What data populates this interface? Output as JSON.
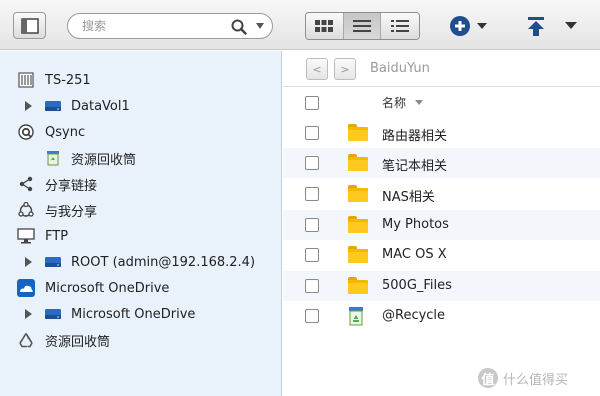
{
  "toolbar": {
    "search": {
      "placeholder": "搜索"
    },
    "view_modes": [
      "thumbnail-view",
      "list-view",
      "detail-view"
    ],
    "active_view": "list-view"
  },
  "sidebar": {
    "items": [
      {
        "label": "TS-251",
        "icon": "nas-icon",
        "indent": 0,
        "expandable": false
      },
      {
        "label": "DataVol1",
        "icon": "drive-icon",
        "indent": 1,
        "expandable": true
      },
      {
        "label": "Qsync",
        "icon": "qsync-icon",
        "indent": 0,
        "expandable": false
      },
      {
        "label": "资源回收筒",
        "icon": "recycle-bin-icon",
        "indent": 2,
        "expandable": false
      },
      {
        "label": "分享链接",
        "icon": "share-link-icon",
        "indent": 0,
        "expandable": false
      },
      {
        "label": "与我分享",
        "icon": "shared-with-me-icon",
        "indent": 0,
        "expandable": false
      },
      {
        "label": "FTP",
        "icon": "ftp-monitor-icon",
        "indent": 0,
        "expandable": false
      },
      {
        "label": "ROOT (admin@192.168.2.4)",
        "icon": "drive-icon",
        "indent": 1,
        "expandable": true
      },
      {
        "label": "Microsoft OneDrive",
        "icon": "onedrive-icon",
        "indent": 0,
        "expandable": false
      },
      {
        "label": "Microsoft OneDrive",
        "icon": "drive-icon",
        "indent": 1,
        "expandable": true
      },
      {
        "label": "资源回收筒",
        "icon": "recycle-icon",
        "indent": 0,
        "expandable": false
      }
    ]
  },
  "main": {
    "nav": {
      "back": "<",
      "forward": ">",
      "path": "BaiduYun"
    },
    "header": {
      "name_col": "名称"
    },
    "files": [
      {
        "name": "路由器相关",
        "icon": "folder-icon"
      },
      {
        "name": "笔记本相关",
        "icon": "folder-icon"
      },
      {
        "name": "NAS相关",
        "icon": "folder-icon"
      },
      {
        "name": "My Photos",
        "icon": "folder-icon"
      },
      {
        "name": "MAC OS X",
        "icon": "folder-icon"
      },
      {
        "name": "500G_Files",
        "icon": "folder-icon"
      },
      {
        "name": "@Recycle",
        "icon": "recycle-bin-icon"
      }
    ]
  },
  "watermark": {
    "badge": "值",
    "text": "什么值得买"
  },
  "colors": {
    "sidebar_bg": "#e9f1fb",
    "accent_blue": "#1f5fa8",
    "folder": "#f4b800"
  }
}
